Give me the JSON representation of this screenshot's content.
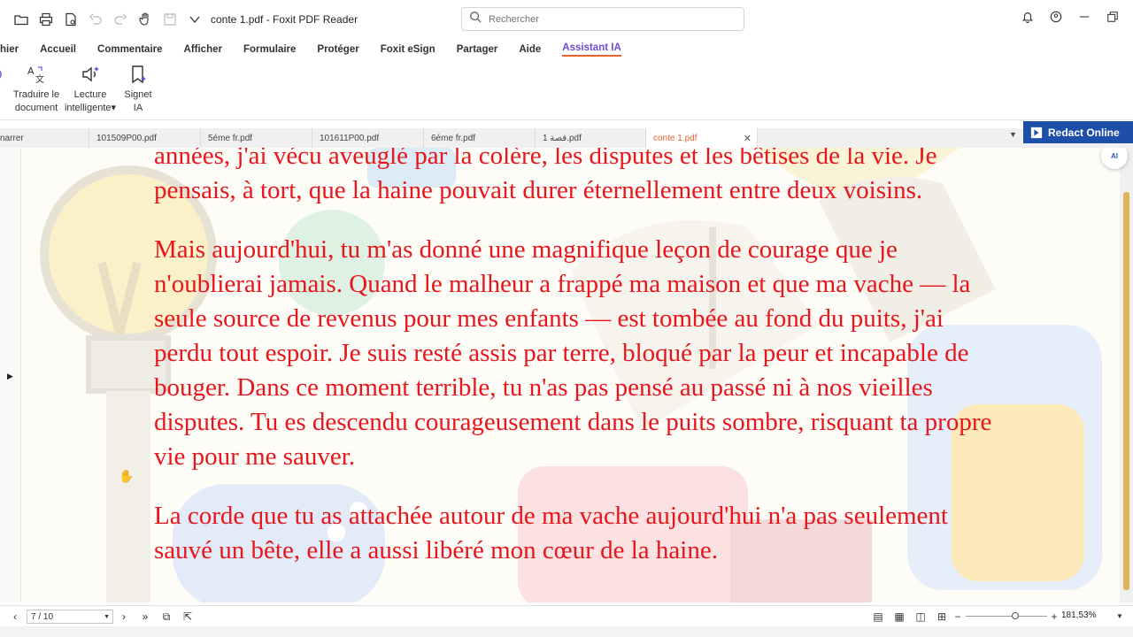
{
  "titlebar": {
    "doc_title": "conte 1.pdf - Foxit PDF Reader",
    "search_placeholder": "Rechercher"
  },
  "menu": {
    "items": [
      "hier",
      "Accueil",
      "Commentaire",
      "Afficher",
      "Formulaire",
      "Protéger",
      "Foxit eSign",
      "Partager",
      "Aide",
      "Assistant IA"
    ],
    "active": "Assistant IA"
  },
  "ribbon": {
    "translate_line1": "Traduire le",
    "translate_line2": "document",
    "reading_line1": "Lecture",
    "reading_line2": "intelligente",
    "bookmark_line1": "Signet",
    "bookmark_line2": "IA"
  },
  "tabs": [
    {
      "label": "narrer"
    },
    {
      "label": "101509P00.pdf"
    },
    {
      "label": "5éme fr.pdf"
    },
    {
      "label": "101611P00.pdf"
    },
    {
      "label": "6éme fr.pdf"
    },
    {
      "label": "1 قصة.pdf"
    },
    {
      "label": "conte 1.pdf",
      "active": true
    }
  ],
  "redact_label": "Redact Online",
  "ai_badge": "AI",
  "document": {
    "paragraphs": [
      "années, j'ai vécu aveuglé par la colère, les disputes et les bêtises de la vie. Je pensais, à tort, que la haine pouvait durer éternellement entre deux voisins.",
      "Mais aujourd'hui, tu m'as donné une magnifique leçon de courage que je n'oublierai jamais. Quand le malheur a frappé ma maison et que ma vache — la seule source de revenus pour mes enfants — est tombée au fond du puits, j'ai perdu tout espoir. Je suis resté assis par terre, bloqué par la peur et incapable de bouger. Dans ce moment terrible, tu n'as pas pensé au passé ni à nos vieilles disputes. Tu es descendu courageusement dans le puits sombre, risquant ta propre vie pour me sauver.",
      "La corde que tu as attachée autour de ma vache aujourd'hui n'a pas seulement sauvé un bête, elle a aussi libéré mon cœur de la haine."
    ]
  },
  "status": {
    "page_indicator": "7 / 10",
    "zoom": "181,53%"
  },
  "colors": {
    "text_red": "#e8161c",
    "accent_purple": "#6b4ad8",
    "tab_active": "#e8622c",
    "redact_blue": "#1e4fa8"
  }
}
